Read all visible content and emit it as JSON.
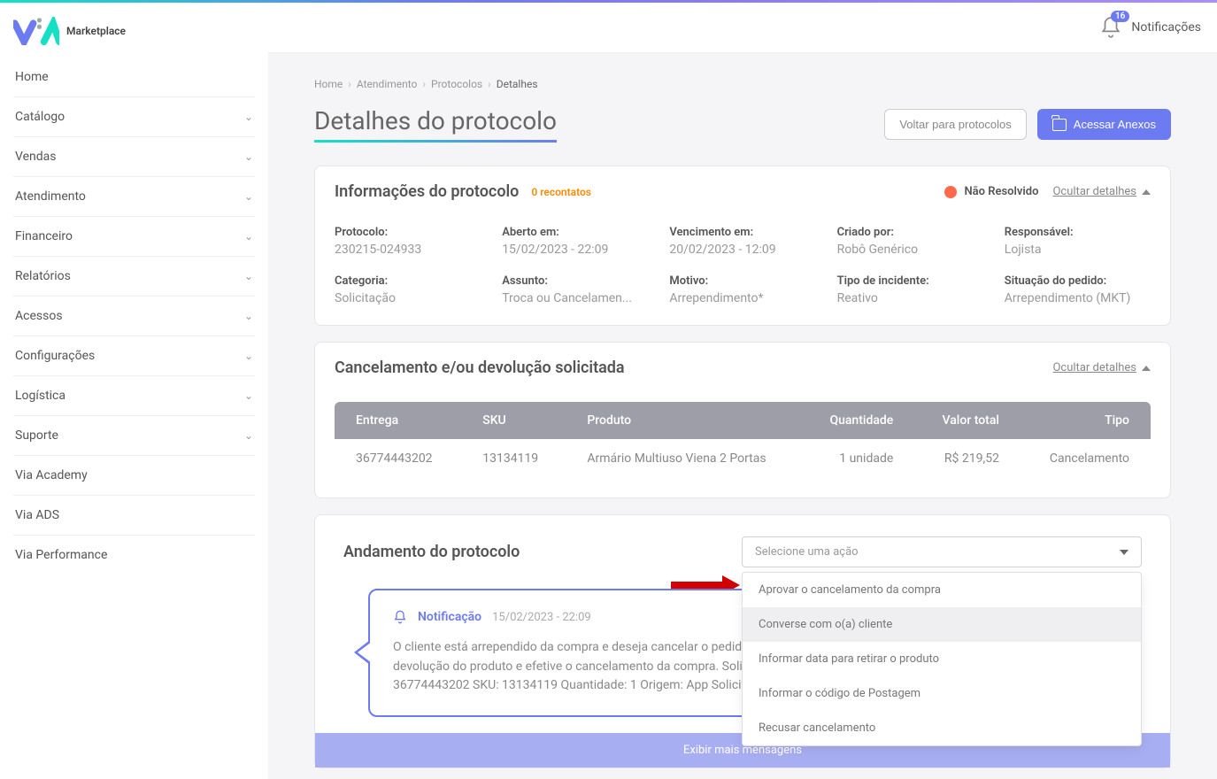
{
  "logo_text": "Marketplace",
  "topbar": {
    "notif_count": "16",
    "notif_label": "Notificações"
  },
  "sidebar": {
    "items": [
      {
        "label": "Home",
        "expandable": false
      },
      {
        "label": "Catálogo",
        "expandable": true
      },
      {
        "label": "Vendas",
        "expandable": true
      },
      {
        "label": "Atendimento",
        "expandable": true
      },
      {
        "label": "Financeiro",
        "expandable": true
      },
      {
        "label": "Relatórios",
        "expandable": true
      },
      {
        "label": "Acessos",
        "expandable": true
      },
      {
        "label": "Configurações",
        "expandable": true
      },
      {
        "label": "Logística",
        "expandable": true
      },
      {
        "label": "Suporte",
        "expandable": true
      },
      {
        "label": "Via Academy",
        "expandable": false
      },
      {
        "label": "Via ADS",
        "expandable": false
      },
      {
        "label": "Via Performance",
        "expandable": false
      }
    ]
  },
  "breadcrumb": [
    "Home",
    "Atendimento",
    "Protocolos",
    "Detalhes"
  ],
  "page_title": "Detalhes do protocolo",
  "header_actions": {
    "back": "Voltar para protocolos",
    "attachments": "Acessar Anexos"
  },
  "info_card": {
    "title": "Informações do protocolo",
    "recontatos": "0 recontatos",
    "status": "Não Resolvido",
    "toggle": "Ocultar detalhes",
    "fields": [
      {
        "label": "Protocolo:",
        "value": "230215-024933"
      },
      {
        "label": "Aberto em:",
        "value": "15/02/2023 - 22:09"
      },
      {
        "label": "Vencimento em:",
        "value": "20/02/2023 - 12:09"
      },
      {
        "label": "Criado por:",
        "value": "Robô Genérico"
      },
      {
        "label": "Responsável:",
        "value": "Lojista"
      },
      {
        "label": "Categoria:",
        "value": "Solicitação"
      },
      {
        "label": "Assunto:",
        "value": "Troca ou Cancelamen..."
      },
      {
        "label": "Motivo:",
        "value": "Arrependimento*"
      },
      {
        "label": "Tipo de incidente:",
        "value": "Reativo"
      },
      {
        "label": "Situação do pedido:",
        "value": "Arrependimento (MKT)"
      }
    ]
  },
  "cancel_card": {
    "title": "Cancelamento e/ou devolução solicitada",
    "toggle": "Ocultar detalhes",
    "columns": [
      "Entrega",
      "SKU",
      "Produto",
      "Quantidade",
      "Valor total",
      "Tipo"
    ],
    "rows": [
      {
        "entrega": "36774443202",
        "sku": "13134119",
        "produto": "Armário Multiuso Viena 2 Portas",
        "quantidade": "1 unidade",
        "valor": "R$ 219,52",
        "tipo": "Cancelamento"
      }
    ]
  },
  "andamento": {
    "title": "Andamento do protocolo",
    "select_placeholder": "Selecione uma ação",
    "options": [
      "Aprovar o cancelamento da compra",
      "Converse com o(a) cliente",
      "Informar data para retirar o produto",
      "Informar o código de Postagem",
      "Recusar cancelamento"
    ],
    "message": {
      "tag": "Notificação",
      "date": "15/02/2023 - 22:09",
      "body": "O cliente está arrependido da compra e deseja cancelar o pedido, caso o produto já tenha sido enviado, oriente o cliente sobre a devolução do produto e efetive o cancelamento da compra. Solicitação: cancelamento Motivo: Arrependimento Entrega: 36774443202 SKU: 13134119 Quantidade: 1 Origem: App Solicitação enviada via ios"
    },
    "show_more": "Exibir mais mensagens"
  }
}
